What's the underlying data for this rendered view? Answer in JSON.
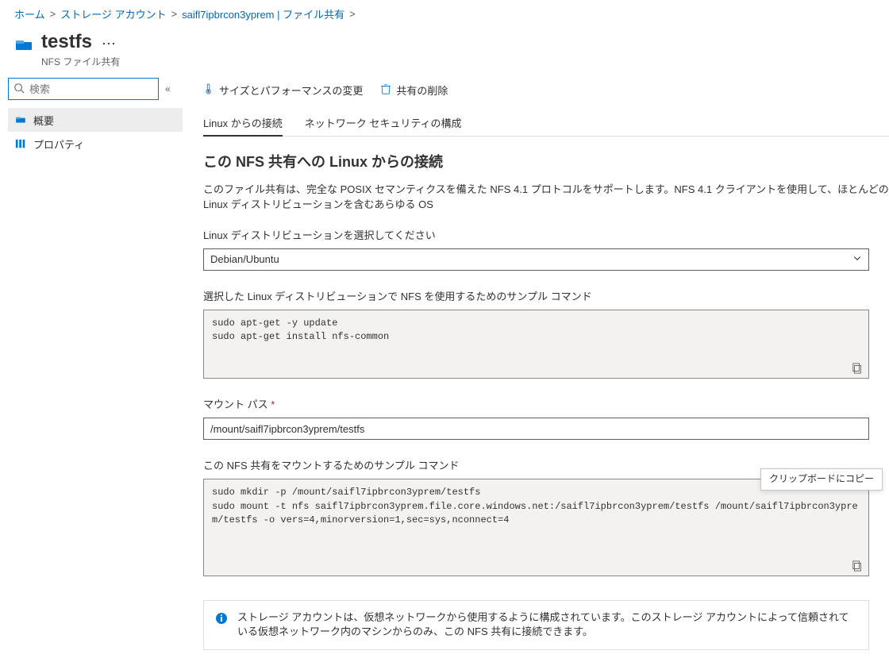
{
  "breadcrumb": {
    "home": "ホーム",
    "storage_accounts": "ストレージ アカウント",
    "account_link": "saifl7ipbrcon3yprem | ファイル共有"
  },
  "title": {
    "name": "testfs",
    "subtitle": "NFS ファイル共有"
  },
  "sidebar": {
    "search_placeholder": "検索",
    "items": [
      {
        "label": "概要"
      },
      {
        "label": "プロパティ"
      }
    ]
  },
  "toolbar": {
    "size_perf": "サイズとパフォーマンスの変更",
    "delete": "共有の削除"
  },
  "tabs": {
    "linux": "Linux からの接続",
    "netsec": "ネットワーク セキュリティの構成"
  },
  "content": {
    "section_title": "この NFS 共有への Linux からの接続",
    "desc": "このファイル共有は、完全な POSIX セマンティクスを備えた NFS 4.1 プロトコルをサポートします。NFS 4.1 クライアントを使用して、ほとんどの Linux ディストリビューションを含むあらゆる OS",
    "distro_label": "Linux ディストリビューションを選択してください",
    "distro_value": "Debian/Ubuntu",
    "sample_setup_label": "選択した Linux ディストリビューションで NFS を使用するためのサンプル コマンド",
    "sample_setup_code": "sudo apt-get -y update\nsudo apt-get install nfs-common",
    "mount_path_label": "マウント パス",
    "mount_path_value": "/mount/saifl7ipbrcon3yprem/testfs",
    "mount_cmd_label": "この NFS 共有をマウントするためのサンプル コマンド",
    "mount_cmd_code": "sudo mkdir -p /mount/saifl7ipbrcon3yprem/testfs\nsudo mount -t nfs saifl7ipbrcon3yprem.file.core.windows.net:/saifl7ipbrcon3yprem/testfs /mount/saifl7ipbrcon3yprem/testfs -o vers=4,minorversion=1,sec=sys,nconnect=4",
    "tooltip_copy": "クリップボードにコピー",
    "info_banner": "ストレージ アカウントは、仮想ネットワークから使用するように構成されています。このストレージ アカウントによって信頼されている仮想ネットワーク内のマシンからのみ、この NFS 共有に接続できます。"
  }
}
